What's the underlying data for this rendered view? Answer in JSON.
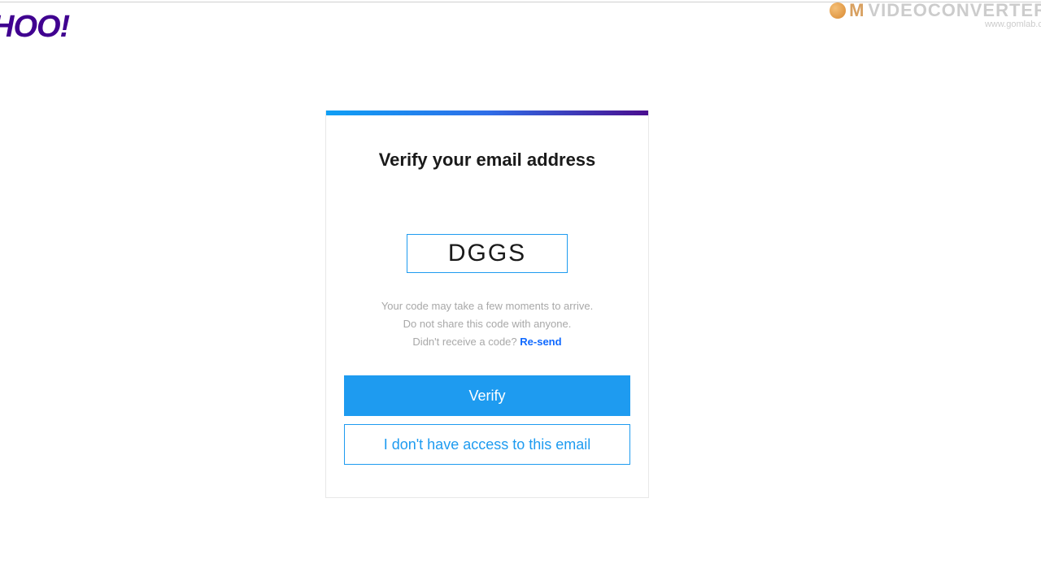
{
  "brand": {
    "logo_text": "HOO!"
  },
  "watermark": {
    "main": "VIDEOCONVERTER",
    "prefix_icon": "globe-icon",
    "sub": "www.gomlab.co"
  },
  "card": {
    "title": "Verify your email address",
    "code_value": "DGGS",
    "help_line1": "Your code may take a few moments to arrive.",
    "help_line2": "Do not share this code with anyone.",
    "help_prompt": "Didn't receive a code? ",
    "resend_label": "Re-send",
    "verify_label": "Verify",
    "no_access_label": "I don't have access to this email"
  },
  "colors": {
    "brand_purple": "#400090",
    "accent_blue": "#1e9bf0",
    "link_blue": "#0f69ff"
  }
}
